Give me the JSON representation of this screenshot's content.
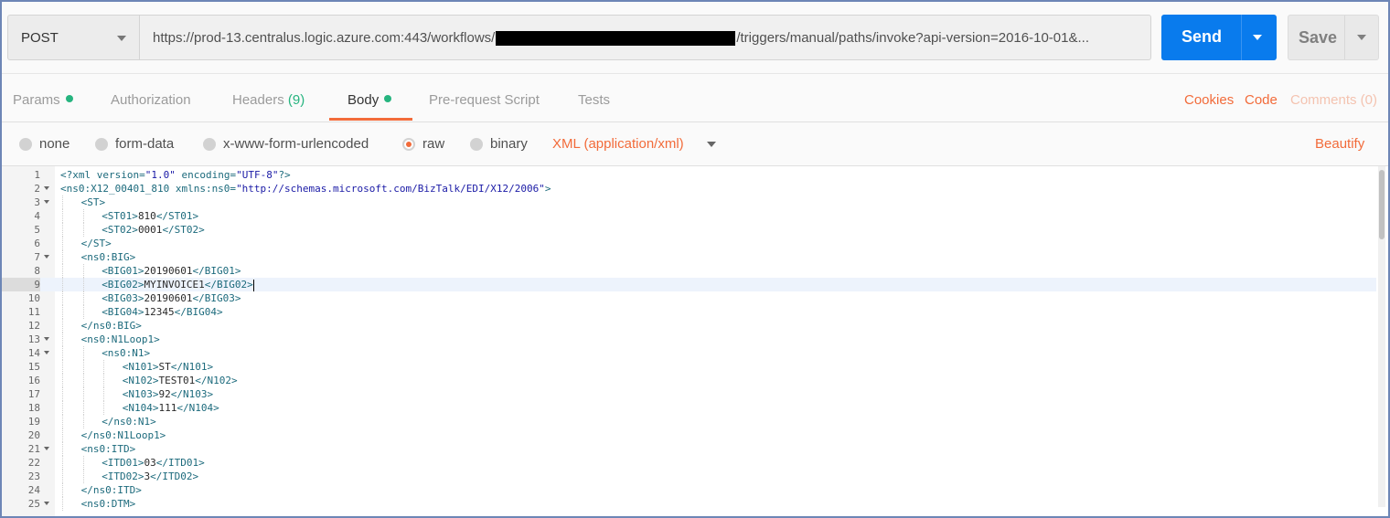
{
  "request": {
    "method": "POST",
    "url_prefix": "https://prod-13.centralus.logic.azure.com:443/workflows/",
    "url_suffix": "/triggers/manual/paths/invoke?api-version=2016-10-01&...",
    "send_label": "Send",
    "save_label": "Save"
  },
  "tabs": [
    {
      "label": "Params",
      "has_dot": true
    },
    {
      "label": "Authorization"
    },
    {
      "label": "Headers",
      "count": "(9)"
    },
    {
      "label": "Body",
      "has_dot": true,
      "active": true
    },
    {
      "label": "Pre-request Script"
    },
    {
      "label": "Tests"
    }
  ],
  "right_links": {
    "cookies": "Cookies",
    "code": "Code",
    "comments": "Comments (0)"
  },
  "body_types": [
    {
      "label": "none",
      "selected": false
    },
    {
      "label": "form-data",
      "selected": false
    },
    {
      "label": "x-www-form-urlencoded",
      "selected": false
    },
    {
      "label": "raw",
      "selected": true
    },
    {
      "label": "binary",
      "selected": false
    }
  ],
  "content_type": "XML (application/xml)",
  "beautify_label": "Beautify",
  "editor": {
    "highlight_line": 9,
    "lines": [
      {
        "n": "1",
        "indent": 0,
        "fold": false,
        "text": "<?xml version=\"1.0\" encoding=\"UTF-8\"?>"
      },
      {
        "n": "2",
        "indent": 0,
        "fold": true,
        "text": "<ns0:X12_00401_810 xmlns:ns0=\"http://schemas.microsoft.com/BizTalk/EDI/X12/2006\">"
      },
      {
        "n": "3",
        "indent": 1,
        "fold": true,
        "text": "<ST>"
      },
      {
        "n": "4",
        "indent": 2,
        "fold": false,
        "text": "<ST01>810</ST01>"
      },
      {
        "n": "5",
        "indent": 2,
        "fold": false,
        "text": "<ST02>0001</ST02>"
      },
      {
        "n": "6",
        "indent": 1,
        "fold": false,
        "text": "</ST>"
      },
      {
        "n": "7",
        "indent": 1,
        "fold": true,
        "text": "<ns0:BIG>"
      },
      {
        "n": "8",
        "indent": 2,
        "fold": false,
        "text": "<BIG01>20190601</BIG01>"
      },
      {
        "n": "9",
        "indent": 2,
        "fold": false,
        "text": "<BIG02>MYINVOICE1</BIG02>"
      },
      {
        "n": "10",
        "indent": 2,
        "fold": false,
        "text": "<BIG03>20190601</BIG03>"
      },
      {
        "n": "11",
        "indent": 2,
        "fold": false,
        "text": "<BIG04>12345</BIG04>"
      },
      {
        "n": "12",
        "indent": 1,
        "fold": false,
        "text": "</ns0:BIG>"
      },
      {
        "n": "13",
        "indent": 1,
        "fold": true,
        "text": "<ns0:N1Loop1>"
      },
      {
        "n": "14",
        "indent": 2,
        "fold": true,
        "text": "<ns0:N1>"
      },
      {
        "n": "15",
        "indent": 3,
        "fold": false,
        "text": "<N101>ST</N101>"
      },
      {
        "n": "16",
        "indent": 3,
        "fold": false,
        "text": "<N102>TEST01</N102>"
      },
      {
        "n": "17",
        "indent": 3,
        "fold": false,
        "text": "<N103>92</N103>"
      },
      {
        "n": "18",
        "indent": 3,
        "fold": false,
        "text": "<N104>111</N104>"
      },
      {
        "n": "19",
        "indent": 2,
        "fold": false,
        "text": "</ns0:N1>"
      },
      {
        "n": "20",
        "indent": 1,
        "fold": false,
        "text": "</ns0:N1Loop1>"
      },
      {
        "n": "21",
        "indent": 1,
        "fold": true,
        "text": "<ns0:ITD>"
      },
      {
        "n": "22",
        "indent": 2,
        "fold": false,
        "text": "<ITD01>03</ITD01>"
      },
      {
        "n": "23",
        "indent": 2,
        "fold": false,
        "text": "<ITD02>3</ITD02>"
      },
      {
        "n": "24",
        "indent": 1,
        "fold": false,
        "text": "</ns0:ITD>"
      },
      {
        "n": "25",
        "indent": 1,
        "fold": true,
        "text": "<ns0:DTM>"
      }
    ]
  }
}
